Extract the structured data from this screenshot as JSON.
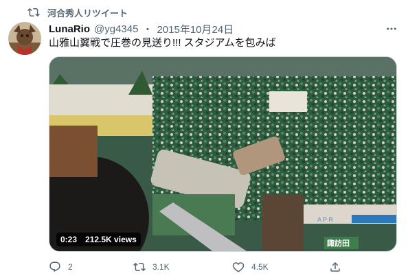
{
  "retweet_context": {
    "label": "河合秀人リツイート"
  },
  "tweet": {
    "author_name": "LunaRio",
    "handle": "@yg4345",
    "separator": "・",
    "date": "2015年10月24日",
    "text": "山雅山翼戦で圧巻の見送り!!! スタジアムを包みば"
  },
  "video": {
    "duration": "0:23",
    "views": "212.5K views",
    "stand_signs": [
      "A P R",
      "諏訪田"
    ]
  },
  "actions": {
    "reply_count": "2",
    "retweet_count": "3.1K",
    "like_count": "4.5K"
  },
  "colors": {
    "text_primary": "#0f1419",
    "text_secondary": "#536471",
    "border": "#cfd9de",
    "crowd_green": "#2f6b4a"
  },
  "icons": [
    "retweet-icon",
    "more-icon",
    "reply-icon",
    "like-icon",
    "share-icon"
  ]
}
